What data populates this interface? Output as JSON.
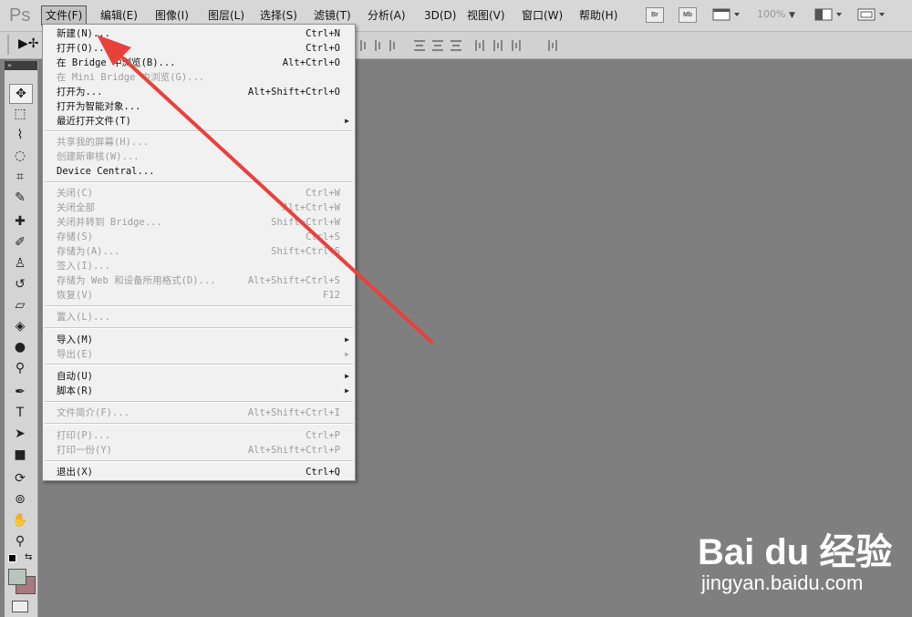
{
  "app": {
    "logo": "Ps"
  },
  "menubar": {
    "items": [
      {
        "label": "文件(F)"
      },
      {
        "label": "编辑(E)"
      },
      {
        "label": "图像(I)"
      },
      {
        "label": "图层(L)"
      },
      {
        "label": "选择(S)"
      },
      {
        "label": "滤镜(T)"
      },
      {
        "label": "分析(A)"
      },
      {
        "label": "3D(D)"
      },
      {
        "label": "视图(V)"
      },
      {
        "label": "窗口(W)"
      },
      {
        "label": "帮助(H)"
      }
    ],
    "bridge_label": "Br",
    "minibridge_label": "Mb",
    "zoom_value": "100%"
  },
  "file_menu": {
    "items": [
      {
        "label": "新建(N)...",
        "shortcut": "Ctrl+N",
        "disabled": false
      },
      {
        "label": "打开(O)...",
        "shortcut": "Ctrl+O",
        "disabled": false
      },
      {
        "label": "在 Bridge 中浏览(B)...",
        "shortcut": "Alt+Ctrl+O",
        "disabled": false
      },
      {
        "label": "在 Mini Bridge 中浏览(G)...",
        "shortcut": "",
        "disabled": true
      },
      {
        "label": "打开为...",
        "shortcut": "Alt+Shift+Ctrl+O",
        "disabled": false
      },
      {
        "label": "打开为智能对象...",
        "shortcut": "",
        "disabled": false
      },
      {
        "label": "最近打开文件(T)",
        "shortcut": "",
        "disabled": false,
        "submenu": true
      },
      {
        "label": "共享我的屏幕(H)...",
        "shortcut": "",
        "disabled": true
      },
      {
        "label": "创建新审核(W)...",
        "shortcut": "",
        "disabled": true
      },
      {
        "label": "Device Central...",
        "shortcut": "",
        "disabled": false
      },
      {
        "label": "关闭(C)",
        "shortcut": "Ctrl+W",
        "disabled": true
      },
      {
        "label": "关闭全部",
        "shortcut": "Alt+Ctrl+W",
        "disabled": true
      },
      {
        "label": "关闭并转到 Bridge...",
        "shortcut": "Shift+Ctrl+W",
        "disabled": true
      },
      {
        "label": "存储(S)",
        "shortcut": "Ctrl+S",
        "disabled": true
      },
      {
        "label": "存储为(A)...",
        "shortcut": "Shift+Ctrl+S",
        "disabled": true
      },
      {
        "label": "签入(I)...",
        "shortcut": "",
        "disabled": true
      },
      {
        "label": "存储为 Web 和设备所用格式(D)...",
        "shortcut": "Alt+Shift+Ctrl+S",
        "disabled": true
      },
      {
        "label": "恢复(V)",
        "shortcut": "F12",
        "disabled": true
      },
      {
        "label": "置入(L)...",
        "shortcut": "",
        "disabled": true
      },
      {
        "label": "导入(M)",
        "shortcut": "",
        "disabled": false,
        "submenu": true
      },
      {
        "label": "导出(E)",
        "shortcut": "",
        "disabled": true,
        "submenu": true
      },
      {
        "label": "自动(U)",
        "shortcut": "",
        "disabled": false,
        "submenu": true
      },
      {
        "label": "脚本(R)",
        "shortcut": "",
        "disabled": false,
        "submenu": true
      },
      {
        "label": "文件简介(F)...",
        "shortcut": "Alt+Shift+Ctrl+I",
        "disabled": true
      },
      {
        "label": "打印(P)...",
        "shortcut": "Ctrl+P",
        "disabled": true
      },
      {
        "label": "打印一份(Y)",
        "shortcut": "Alt+Shift+Ctrl+P",
        "disabled": true
      },
      {
        "label": "退出(X)",
        "shortcut": "Ctrl+Q",
        "disabled": false
      }
    ]
  },
  "annotation": {
    "color": "#e8413c"
  },
  "watermark": {
    "logo": "Bai du 经验",
    "url": "jingyan.baidu.com"
  }
}
